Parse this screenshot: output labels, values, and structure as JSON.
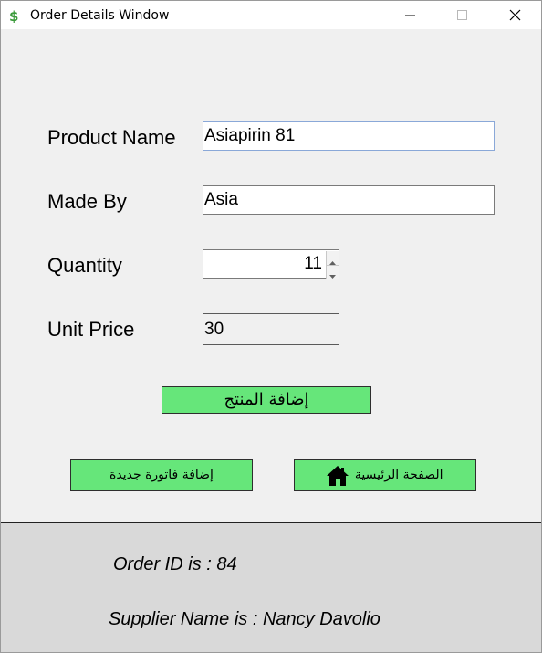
{
  "window": {
    "title": "Order Details Window",
    "icon": "dollar-sign-icon"
  },
  "titlebar_buttons": {
    "minimize_icon": "minimize-icon",
    "maximize_icon": "maximize-icon",
    "close_icon": "close-icon"
  },
  "form": {
    "product_name_label": "Product Name",
    "product_name_value": "Asiapirin 81",
    "made_by_label": "Made By",
    "made_by_value": "Asia",
    "quantity_label": "Quantity",
    "quantity_value": "11",
    "unit_price_label": "Unit Price",
    "unit_price_value": "30"
  },
  "buttons": {
    "add_product": "إضافة المنتج",
    "add_new_invoice": "إضافة فاتورة جديدة",
    "home_page": "الصفحة الرئيسية",
    "home_icon": "home-icon"
  },
  "info": {
    "order_id": "Order ID is : 84",
    "supplier_name": "Supplier Name is : Nancy Davolio"
  },
  "colors": {
    "button_green": "#66e67a",
    "info_background": "#d9d9d9",
    "form_background": "#f0f0f0"
  }
}
